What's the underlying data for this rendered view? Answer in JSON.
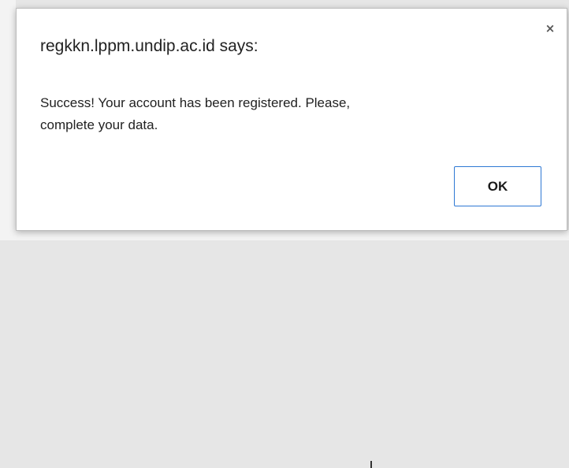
{
  "dialog": {
    "title": "regkkn.lppm.undip.ac.id says:",
    "message_line1": "Success! Your account has been registered. Please,",
    "message_line2": "complete your data.",
    "ok_label": "OK",
    "close_glyph": "×",
    "close_icon": "close-icon"
  },
  "colors": {
    "ok_border": "#2e78d4",
    "backdrop": "#e6e6e6"
  }
}
